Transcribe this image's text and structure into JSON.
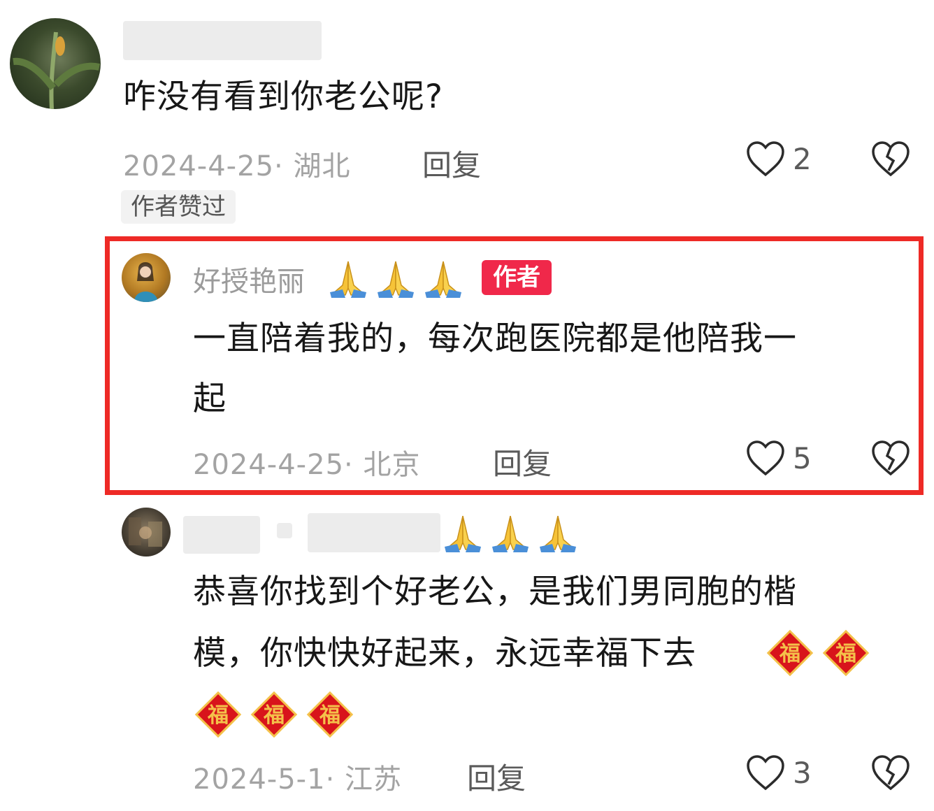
{
  "comments": [
    {
      "text": "咋没有看到你老公呢?",
      "meta": "2024-4-25· 湖北",
      "reply_label": "回复",
      "likes": "2",
      "badge": "作者赞过"
    },
    {
      "nickname": "好授艳丽",
      "author_badge": "作者",
      "text_line1": "一直陪着我的，每次跑医院都是他陪我一",
      "text_line2": "起",
      "meta": "2024-4-25· 北京",
      "reply_label": "回复",
      "likes": "5"
    },
    {
      "text_line1": "恭喜你找到个好老公，是我们男同胞的楷",
      "text_line2": "模，你快快好起来，永远幸福下去",
      "meta": "2024-5-1· 江苏",
      "reply_label": "回复",
      "likes": "3"
    }
  ],
  "icons": {
    "like": "heart-icon",
    "dislike": "broken-heart-icon",
    "pray": "folded-hands-emoji",
    "fortune": "fu-emoji"
  },
  "colors": {
    "highlight_border": "#ee2a26",
    "author_badge": "#f0284a",
    "fu_red": "#d8141b",
    "fu_gold": "#f4c14a"
  }
}
